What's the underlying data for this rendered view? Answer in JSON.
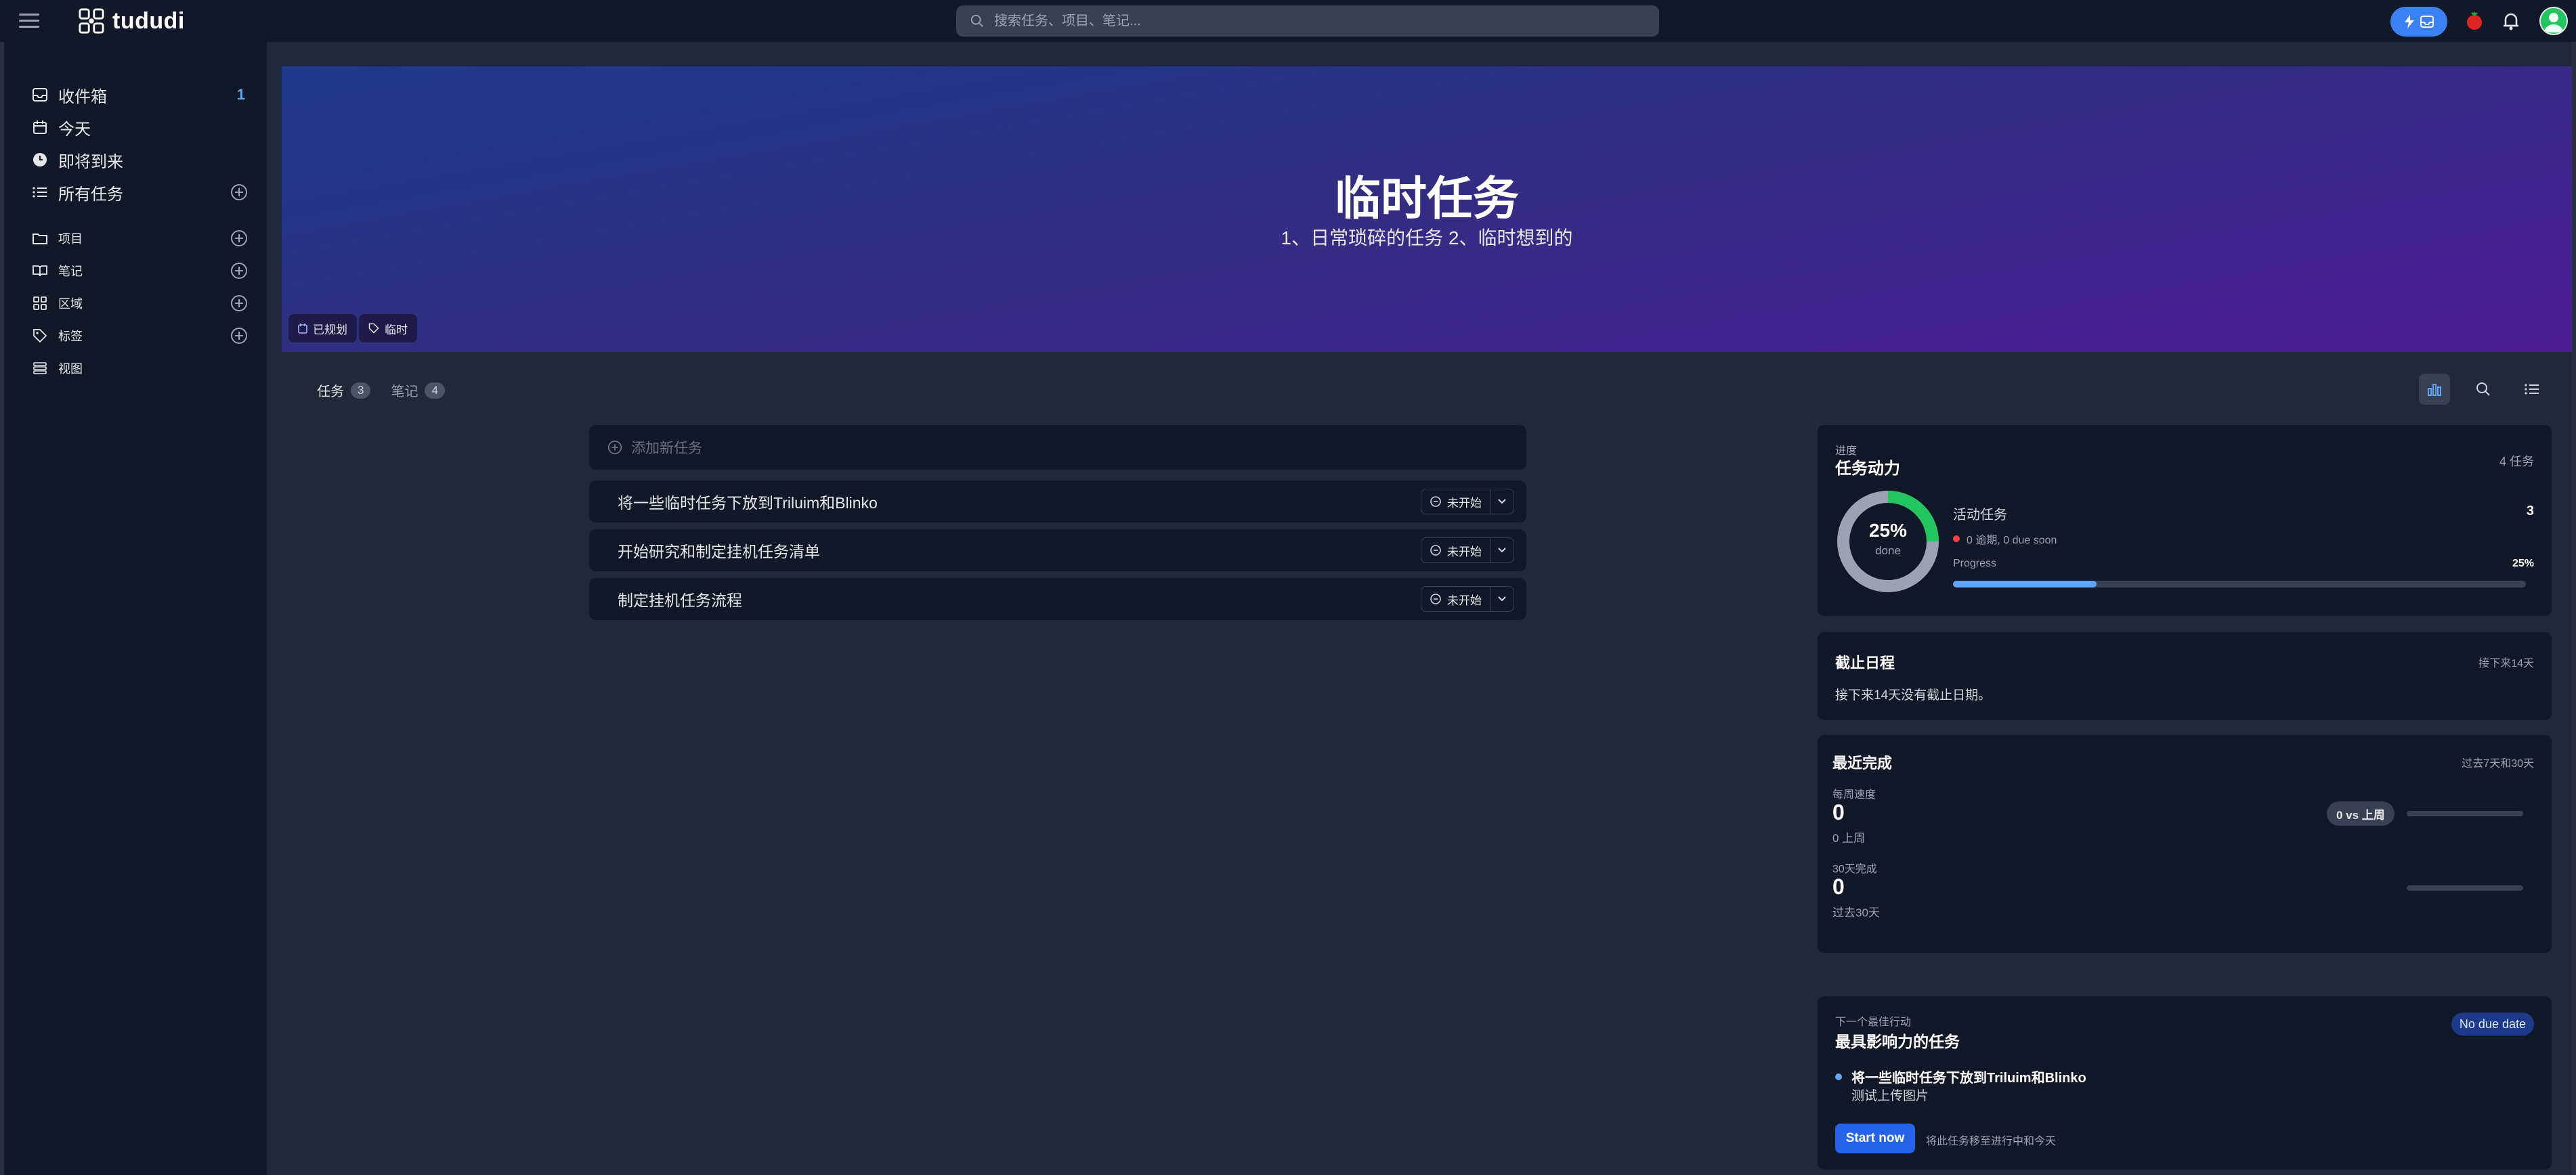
{
  "app": {
    "name": "tududi",
    "search_placeholder": "搜索任务、项目、笔记...",
    "colors": {
      "accent": "#3b82f6",
      "background": "#1f2937",
      "panel": "#111827",
      "success": "#22c55e",
      "danger": "#ef4444"
    }
  },
  "sidebar": {
    "items": [
      {
        "label": "收件箱",
        "icon": "inbox-icon",
        "count": "1"
      },
      {
        "label": "今天",
        "icon": "calendar-icon"
      },
      {
        "label": "即将到来",
        "icon": "clock-icon"
      },
      {
        "label": "所有任务",
        "icon": "list-icon"
      }
    ],
    "sections": [
      {
        "label": "项目",
        "icon": "folder-icon"
      },
      {
        "label": "笔记",
        "icon": "book-icon"
      },
      {
        "label": "区域",
        "icon": "grid-icon"
      },
      {
        "label": "标签",
        "icon": "tag-icon"
      },
      {
        "label": "视图",
        "icon": "stack-icon"
      }
    ]
  },
  "hero": {
    "title": "临时任务",
    "subtitle": "1、日常琐碎的任务 2、临时想到的",
    "badges": [
      "已规划",
      "临时"
    ]
  },
  "tabs": [
    {
      "label": "任务",
      "count": "3"
    },
    {
      "label": "笔记",
      "count": "4"
    }
  ],
  "tasks": {
    "add_placeholder": "添加新任务",
    "items": [
      {
        "title": "将一些临时任务下放到Triluim和Blinko",
        "status": "未开始"
      },
      {
        "title": "开始研究和制定挂机任务清单",
        "status": "未开始"
      },
      {
        "title": "制定挂机任务流程",
        "status": "未开始"
      }
    ]
  },
  "progress_card": {
    "caption": "进度",
    "title": "任务动力",
    "total": "4 任务",
    "percent_label": "25%",
    "percent_value": 0.25,
    "done_label": "done",
    "active_label": "活动任务",
    "active_count": "3",
    "overdue_text": "0 逾期, 0 due soon",
    "progress_label": "Progress",
    "progress_pct": "25%"
  },
  "due_card": {
    "title": "截止日程",
    "range": "接下来14天",
    "empty_text": "接下来14天没有截止日期。"
  },
  "completed_card": {
    "title": "最近完成",
    "range": "过去7天和30天",
    "weekly_label": "每周速度",
    "weekly_value": "0",
    "weekly_sub": "0 上周",
    "compare_label": "0 vs 上周",
    "monthly_label": "30天完成",
    "monthly_value": "0",
    "monthly_sub": "过去30天"
  },
  "next_card": {
    "caption": "下一个最佳行动",
    "title": "最具影响力的任务",
    "badge": "No due date",
    "task_title": "将一些临时任务下放到Triluim和Blinko",
    "task_note": "测试上传图片",
    "start_label": "Start now",
    "hint": "将此任务移至进行中和今天"
  }
}
